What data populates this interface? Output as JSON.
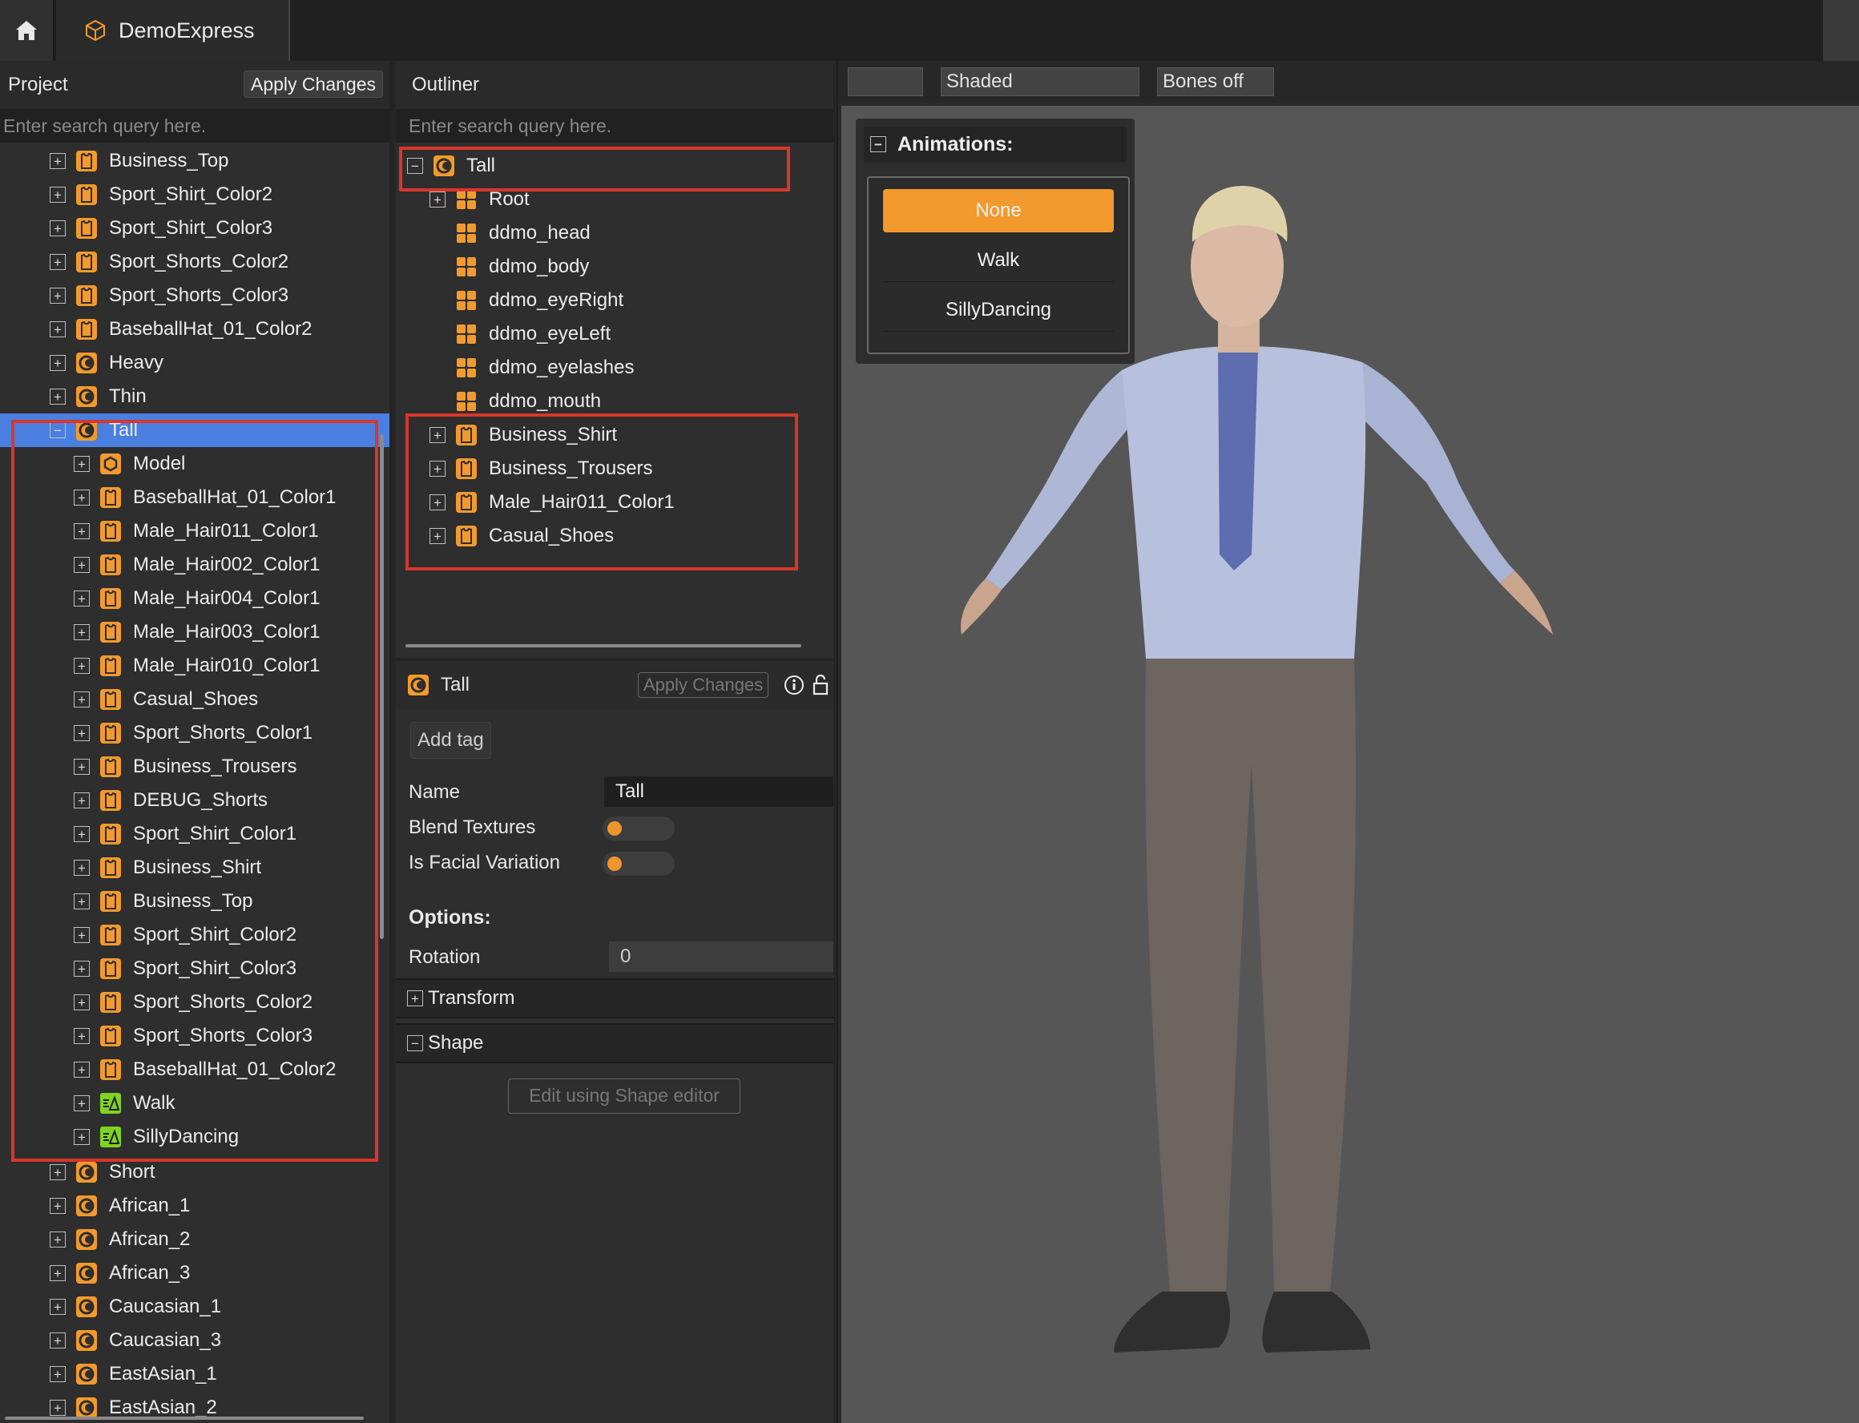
{
  "app": {
    "tab_title": "DemoExpress"
  },
  "project": {
    "title": "Project",
    "apply_label": "Apply Changes",
    "search_placeholder": "Enter search query here.",
    "top_items": [
      {
        "label": "Business_Top",
        "icon": "shirt-icon"
      },
      {
        "label": "Sport_Shirt_Color2",
        "icon": "shirt-icon"
      },
      {
        "label": "Sport_Shirt_Color3",
        "icon": "shirt-icon"
      },
      {
        "label": "Sport_Shorts_Color2",
        "icon": "shirt-icon"
      },
      {
        "label": "Sport_Shorts_Color3",
        "icon": "shirt-icon"
      },
      {
        "label": "BaseballHat_01_Color2",
        "icon": "shirt-icon"
      },
      {
        "label": "Heavy",
        "icon": "character-icon"
      },
      {
        "label": "Thin",
        "icon": "character-icon"
      }
    ],
    "selected": "Tall",
    "tall_children": [
      {
        "label": "Model",
        "icon": "model-icon"
      },
      {
        "label": "BaseballHat_01_Color1",
        "icon": "shirt-icon"
      },
      {
        "label": "Male_Hair011_Color1",
        "icon": "shirt-icon"
      },
      {
        "label": "Male_Hair002_Color1",
        "icon": "shirt-icon"
      },
      {
        "label": "Male_Hair004_Color1",
        "icon": "shirt-icon"
      },
      {
        "label": "Male_Hair003_Color1",
        "icon": "shirt-icon"
      },
      {
        "label": "Male_Hair010_Color1",
        "icon": "shirt-icon"
      },
      {
        "label": "Casual_Shoes",
        "icon": "shirt-icon"
      },
      {
        "label": "Sport_Shorts_Color1",
        "icon": "shirt-icon"
      },
      {
        "label": "Business_Trousers",
        "icon": "shirt-icon"
      },
      {
        "label": "DEBUG_Shorts",
        "icon": "shirt-icon"
      },
      {
        "label": "Sport_Shirt_Color1",
        "icon": "shirt-icon"
      },
      {
        "label": "Business_Shirt",
        "icon": "shirt-icon"
      },
      {
        "label": "Business_Top",
        "icon": "shirt-icon"
      },
      {
        "label": "Sport_Shirt_Color2",
        "icon": "shirt-icon"
      },
      {
        "label": "Sport_Shirt_Color3",
        "icon": "shirt-icon"
      },
      {
        "label": "Sport_Shorts_Color2",
        "icon": "shirt-icon"
      },
      {
        "label": "Sport_Shorts_Color3",
        "icon": "shirt-icon"
      },
      {
        "label": "BaseballHat_01_Color2",
        "icon": "shirt-icon"
      },
      {
        "label": "Walk",
        "icon": "animation-icon"
      },
      {
        "label": "SillyDancing",
        "icon": "animation-icon"
      }
    ],
    "bottom_items": [
      {
        "label": "Short",
        "icon": "character-icon"
      },
      {
        "label": "African_1",
        "icon": "character-icon"
      },
      {
        "label": "African_2",
        "icon": "character-icon"
      },
      {
        "label": "African_3",
        "icon": "character-icon"
      },
      {
        "label": "Caucasian_1",
        "icon": "character-icon"
      },
      {
        "label": "Caucasian_3",
        "icon": "character-icon"
      },
      {
        "label": "EastAsian_1",
        "icon": "character-icon"
      },
      {
        "label": "EastAsian_2",
        "icon": "character-icon"
      }
    ]
  },
  "outliner": {
    "title": "Outliner",
    "search_placeholder": "Enter search query here.",
    "root": "Tall",
    "items": [
      {
        "label": "Root",
        "icon": "mesh-icon",
        "expandable": true
      },
      {
        "label": "ddmo_head",
        "icon": "mesh-icon",
        "expandable": false
      },
      {
        "label": "ddmo_body",
        "icon": "mesh-icon",
        "expandable": false
      },
      {
        "label": "ddmo_eyeRight",
        "icon": "mesh-icon",
        "expandable": false
      },
      {
        "label": "ddmo_eyeLeft",
        "icon": "mesh-icon",
        "expandable": false
      },
      {
        "label": "ddmo_eyelashes",
        "icon": "mesh-icon",
        "expandable": false
      },
      {
        "label": "ddmo_mouth",
        "icon": "mesh-icon",
        "expandable": false
      },
      {
        "label": "Business_Shirt",
        "icon": "shirt-icon",
        "expandable": true
      },
      {
        "label": "Business_Trousers",
        "icon": "shirt-icon",
        "expandable": true
      },
      {
        "label": "Male_Hair011_Color1",
        "icon": "shirt-icon",
        "expandable": true
      },
      {
        "label": "Casual_Shoes",
        "icon": "shirt-icon",
        "expandable": true
      }
    ]
  },
  "inspector": {
    "title": "Tall",
    "apply_label": "Apply Changes",
    "add_tag": "Add tag",
    "name_label": "Name",
    "name_value": "Tall",
    "blend_label": "Blend Textures",
    "blend_on": false,
    "facial_label": "Is Facial Variation",
    "facial_on": false,
    "options_label": "Options:",
    "rotation_label": "Rotation",
    "rotation_value": "0",
    "transform_label": "Transform",
    "shape_label": "Shape",
    "edit_shape_label": "Edit using Shape editor"
  },
  "viewport": {
    "toolbar": {
      "blank": "",
      "shading": "Shaded",
      "bones": "Bones off"
    },
    "animations": {
      "title": "Animations:",
      "items": [
        "None",
        "Walk",
        "SillyDancing"
      ],
      "active": "None"
    }
  },
  "colors": {
    "accent": "#f29a2e",
    "selection": "#4a7fe0",
    "highlight_box": "#d9362b",
    "anim_icon": "#7ed321"
  }
}
